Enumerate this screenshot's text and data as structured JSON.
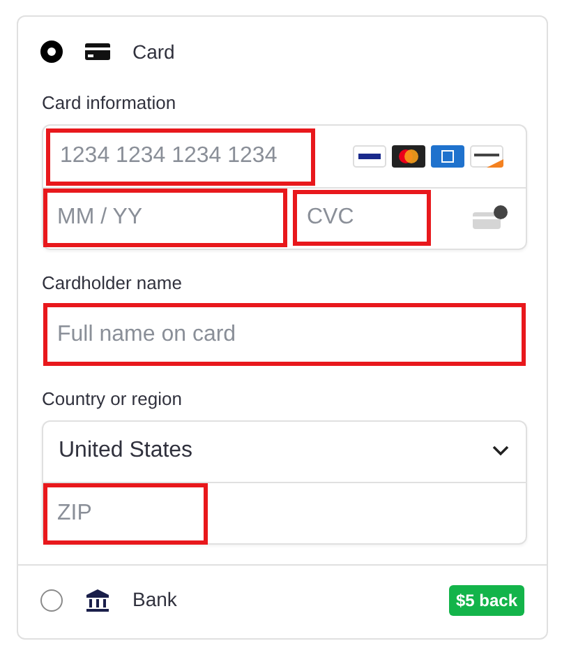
{
  "options": [
    {
      "kind": "card",
      "label": "Card",
      "selected": true,
      "form": {
        "card_information": {
          "label": "Card information",
          "number": {
            "placeholder": "1234 1234 1234 1234",
            "highlighted": true
          },
          "expiry": {
            "placeholder": "MM / YY",
            "highlighted": true
          },
          "cvc": {
            "placeholder": "CVC",
            "highlighted": true
          }
        },
        "cardholder": {
          "label": "Cardholder name",
          "placeholder": "Full name on card",
          "highlighted": true
        },
        "country": {
          "label": "Country or region",
          "value": "United States",
          "zip": {
            "placeholder": "ZIP",
            "highlighted": true
          }
        }
      }
    },
    {
      "kind": "bank",
      "label": "Bank",
      "selected": false,
      "badge": "$5 back"
    }
  ]
}
